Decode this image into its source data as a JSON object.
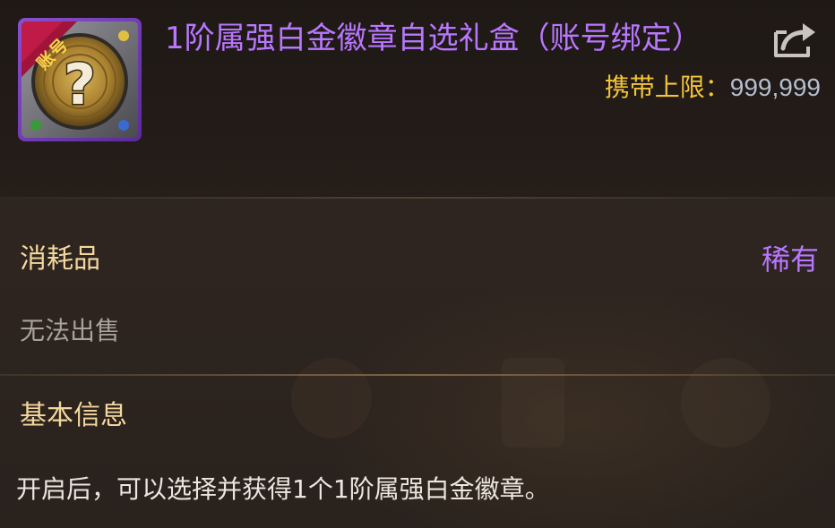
{
  "item": {
    "icon_name": "mystery-badge-box-icon",
    "icon_stamp": "账号",
    "name": "1阶属强白金徽章自选礼盒（账号绑定）",
    "name_color": "#b877ff"
  },
  "carry_limit": {
    "label": "携带上限：",
    "value": "999,999"
  },
  "share_icon": "share-icon",
  "category": "消耗品",
  "rarity": {
    "label": "稀有",
    "color": "#b877ff"
  },
  "sell_status": "无法出售",
  "section": {
    "title": "基本信息",
    "description": "开启后，可以选择并获得1个1阶属强白金徽章。"
  }
}
